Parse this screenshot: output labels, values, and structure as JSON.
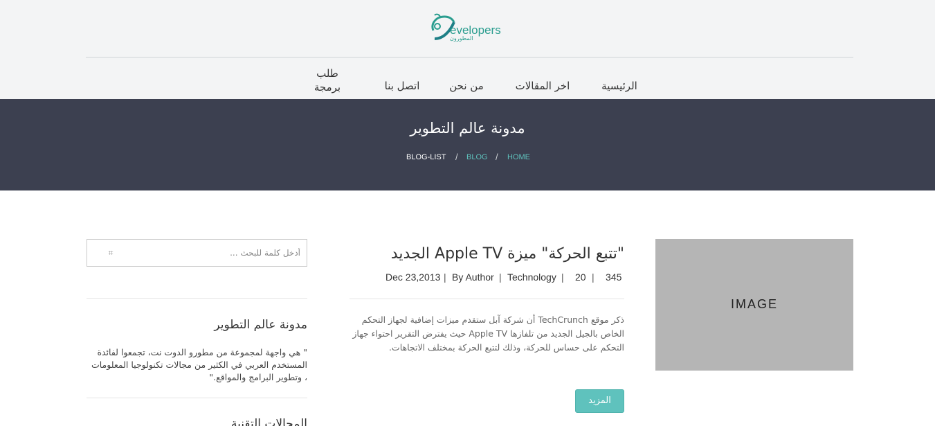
{
  "header": {
    "logo_text": "evelopers",
    "logo_sub": "المطورون",
    "nav": [
      {
        "label": "الرئيسية"
      },
      {
        "label": "اخر المقالات"
      },
      {
        "label": "من نحن"
      },
      {
        "label": "اتصل بنا"
      },
      {
        "label": "طلب برمجة"
      }
    ]
  },
  "banner": {
    "title": "مدونة عالم التطوير",
    "breadcrumb": {
      "home": "HOME",
      "blog": "BLOG",
      "current": "BLOG-LIST",
      "separator": "/"
    }
  },
  "sidebar": {
    "search": {
      "placeholder": "أدخل كلمة للبحث ..."
    },
    "about": {
      "title": "مدونة عالم التطوير",
      "text": "\" هي واجهة لمجموعة من مطورو الدوت نت، تجمعوا لفائدة المستخدم العربي في الكثير من مجالات تكنولوجيا المعلومات ، وتطوير البرامج والمواقع.\""
    },
    "next_title": "المجالات التقنية"
  },
  "article": {
    "title": "\"تتبع الحركة\" ميزة Apple TV الجديد",
    "meta": {
      "date": "Dec 23,2013",
      "author": "By Author",
      "category": "Technology",
      "count1": "20",
      "count2": "345",
      "separator": "|"
    },
    "excerpt": "ذكر موقع TechCrunch أن شركة آبل ستقدم ميزات إضافية لجهاز التحكم الخاص بالجيل الجديد من تلفازها Apple TV حيث يفترض التقرير احتواء جهاز التحكم على حساس للحركة، وذلك لتتبع الحركة بمختلف الاتجاهات.",
    "more_label": "المزيد",
    "image_label": "IMAGE"
  },
  "colors": {
    "accent": "#5fc2bd",
    "banner_bg": "#3c4050",
    "header_bg": "#f3f4f5",
    "image_placeholder": "#b5b5b5"
  }
}
